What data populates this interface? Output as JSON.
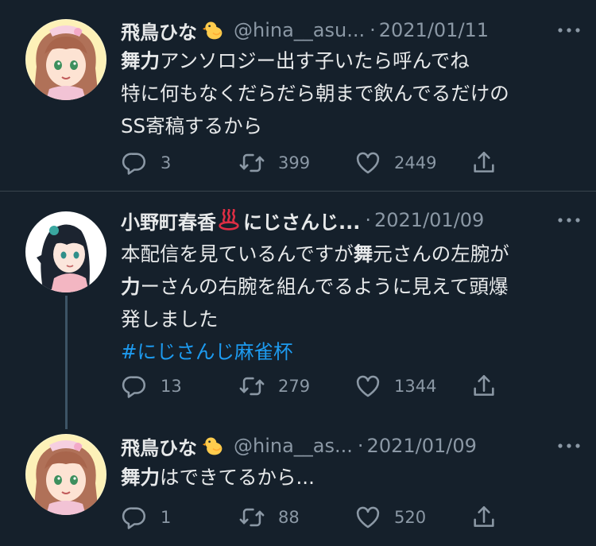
{
  "tweets": [
    {
      "name": "飛鳥ひな",
      "handle": "@hina__asu...",
      "dot": "·",
      "date": "2021/01/11",
      "body_lines": [
        [
          {
            "text": "舞力",
            "bold": true
          },
          {
            "text": "アンソロジー出す子いたら呼んでね"
          }
        ],
        [
          {
            "text": "特に何もなくだらだら朝まで飲んでるだけの"
          }
        ],
        [
          {
            "text": "SS寄稿するから"
          }
        ]
      ],
      "replies": "3",
      "retweets": "399",
      "likes": "2449"
    },
    {
      "name": "小野町春香",
      "name_suffix": "にじさんじ...",
      "dot": "·",
      "date": "2021/01/09",
      "body_lines": [
        [
          {
            "text": "本配信を見ているんですが"
          },
          {
            "text": "舞",
            "bold": true
          },
          {
            "text": "元さんの左腕が"
          }
        ],
        [
          {
            "text": "力",
            "bold": true
          },
          {
            "text": "ーさんの右腕を組んでるように見えて頭爆"
          }
        ],
        [
          {
            "text": "発しました"
          }
        ],
        [
          {
            "text": "#にじさんじ麻雀杯",
            "hashtag": true
          }
        ]
      ],
      "replies": "13",
      "retweets": "279",
      "likes": "1344"
    },
    {
      "name": "飛鳥ひな",
      "handle": "@hina__as...",
      "dot": "·",
      "date": "2021/01/09",
      "body_lines": [
        [
          {
            "text": "舞力",
            "bold": true
          },
          {
            "text": "はできてるから..."
          }
        ]
      ],
      "replies": "1",
      "retweets": "88",
      "likes": "520"
    }
  ],
  "icons": {
    "more": "more-horizontal-icon",
    "reply": "reply-icon",
    "retweet": "retweet-icon",
    "like": "heart-icon",
    "share": "share-icon",
    "chick": "baby-chick-emoji",
    "hotspring": "hot-springs-emoji"
  },
  "colors": {
    "background": "#15202b",
    "text": "#e7e9ea",
    "secondary": "#8b98a5",
    "hashtag": "#1d9bf0",
    "divider": "#38444d"
  }
}
